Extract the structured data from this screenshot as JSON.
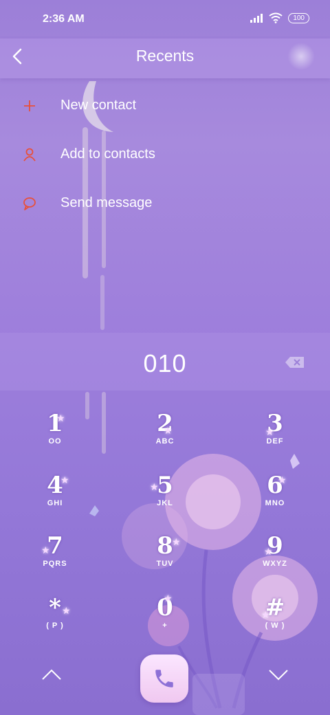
{
  "status": {
    "time": "2:36 AM",
    "battery": "100"
  },
  "header": {
    "title": "Recents"
  },
  "menu": {
    "items": [
      {
        "label": "New contact",
        "icon": "plus-icon"
      },
      {
        "label": "Add to contacts",
        "icon": "person-icon"
      },
      {
        "label": "Send message",
        "icon": "message-icon"
      }
    ]
  },
  "dialer": {
    "number": "010"
  },
  "keypad": {
    "keys": [
      {
        "digit": "1",
        "letters": "OO"
      },
      {
        "digit": "2",
        "letters": "ABC"
      },
      {
        "digit": "3",
        "letters": "DEF"
      },
      {
        "digit": "4",
        "letters": "GHI"
      },
      {
        "digit": "5",
        "letters": "JKL"
      },
      {
        "digit": "6",
        "letters": "MNO"
      },
      {
        "digit": "7",
        "letters": "PQRS"
      },
      {
        "digit": "8",
        "letters": "TUV"
      },
      {
        "digit": "9",
        "letters": "WXYZ"
      },
      {
        "digit": "*",
        "letters": "( P )"
      },
      {
        "digit": "0",
        "letters": "+"
      },
      {
        "digit": "#",
        "letters": "( W )"
      }
    ]
  },
  "colors": {
    "accent_icon": "#e8503a",
    "bg_top": "#a78add",
    "bg_bottom": "#8a6ed0"
  }
}
